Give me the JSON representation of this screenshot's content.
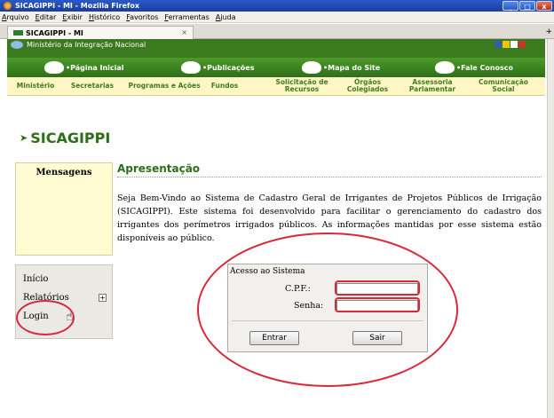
{
  "window": {
    "title": "SICAGIPPI - MI - Mozilla Firefox"
  },
  "menubar": [
    "Arquivo",
    "Editar",
    "Exibir",
    "Histórico",
    "Favoritos",
    "Ferramentas",
    "Ajuda"
  ],
  "tab": {
    "label": "SICAGIPPI - MI",
    "close": "×",
    "new": "+"
  },
  "site": {
    "ministry": "Ministério da Integração Nacional",
    "topnav": [
      "•Página Inicial",
      "•Publicações",
      "•Mapa do Site",
      "•Fale Conosco"
    ],
    "yellowmenu": [
      "Ministério",
      "Secretarias",
      "Programas e Ações",
      "Fundos",
      "Solicitação de Recursos",
      "Órgãos Colegiados",
      "Assessoria Parlamentar",
      "Comunicação Social"
    ]
  },
  "page": {
    "title": "SICAGIPPI",
    "messages_header": "Mensagens",
    "heading": "Apresentação",
    "intro": "Seja Bem-Vindo ao Sistema de Cadastro Geral de Irrigantes de Projetos Públicos de Irrigação (SICAGIPPI). Este sistema foi desenvolvido para facilitar o gerenciamento do cadastro dos irrigantes dos perímetros irrigados públicos. As informações mantidas por esse sistema estão disponíveis ao público."
  },
  "sidemenu": {
    "items": [
      "Início",
      "Relatórios",
      "Login"
    ],
    "expand": "+"
  },
  "login": {
    "title": "Acesso ao Sistema",
    "cpf_label": "C.P.F.:",
    "senha_label": "Senha:",
    "cpf_value": "",
    "senha_value": "",
    "enter": "Entrar",
    "exit": "Sair"
  },
  "colors": {
    "green": "#3c7a20",
    "highlight": "#d8283a"
  },
  "icons": [
    "firefox-icon",
    "home-icon",
    "publications-icon",
    "sitemap-icon",
    "contact-icon",
    "pointer-hand-icon"
  ]
}
